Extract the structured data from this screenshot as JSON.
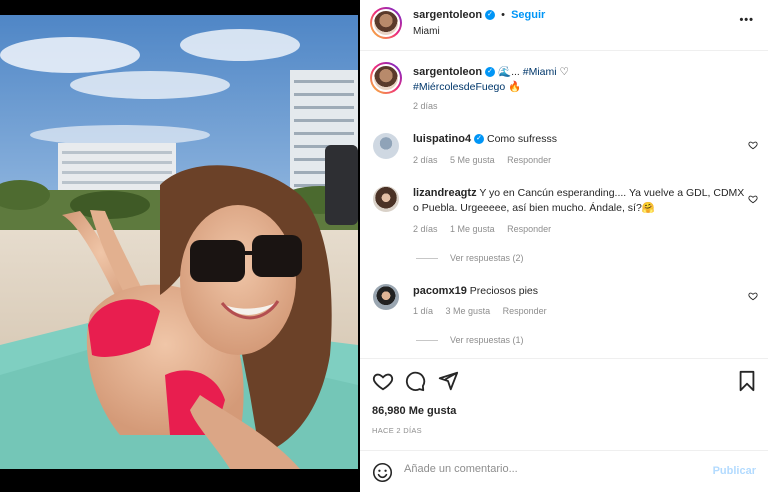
{
  "post": {
    "username": "sargentoleon",
    "follow_label": "Seguir",
    "location": "Miami",
    "more_label": "•••",
    "caption_emoji": "🌊...",
    "caption_hashtag1": "#Miami",
    "caption_heart": "♡",
    "caption_hashtag2": "#MiércolesdeFuego",
    "caption_fire": "🔥",
    "caption_time": "2 días"
  },
  "comments": [
    {
      "username": "luispatino4",
      "verified": true,
      "text": "Como sufresss",
      "time": "2 días",
      "likes": "5 Me gusta",
      "reply": "Responder"
    },
    {
      "username": "lizandreagtz",
      "verified": false,
      "text": "Y yo en Cancún esperanding.... Ya vuelve a GDL, CDMX o Puebla. Urgeeeee, así bien mucho. Ándale, sí?🤗",
      "time": "2 días",
      "likes": "1 Me gusta",
      "reply": "Responder",
      "view_replies": "Ver respuestas (2)"
    },
    {
      "username": "pacomx19",
      "verified": false,
      "text": "Preciosos pies",
      "time": "1 día",
      "likes": "3 Me gusta",
      "reply": "Responder",
      "view_replies": "Ver respuestas (1)"
    }
  ],
  "stats": {
    "likes": "86,980 Me gusta",
    "ago": "HACE 2 DÍAS"
  },
  "comment_box": {
    "placeholder": "Añade un comentario...",
    "publish_label": "Publicar"
  },
  "colors": {
    "accent": "#0095f6",
    "publish_disabled": "#b3dbff",
    "muted": "#8e8e8e"
  },
  "icons": [
    "heart-icon",
    "comment-icon",
    "share-icon",
    "bookmark-icon",
    "emoji-icon",
    "more-icon",
    "verified-icon"
  ]
}
